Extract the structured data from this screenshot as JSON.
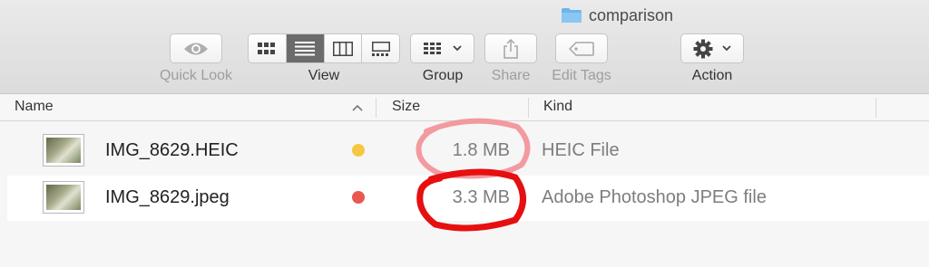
{
  "window": {
    "title": "comparison"
  },
  "toolbar": {
    "quick_look": "Quick Look",
    "view": "View",
    "group": "Group",
    "share": "Share",
    "edit_tags": "Edit Tags",
    "action": "Action"
  },
  "columns": {
    "name": "Name",
    "size": "Size",
    "kind": "Kind"
  },
  "files": [
    {
      "name": "IMG_8629.HEIC",
      "size": "1.8 MB",
      "kind": "HEIC File",
      "tag_color": "#f5c742"
    },
    {
      "name": "IMG_8629.jpeg",
      "size": "3.3 MB",
      "kind": "Adobe Photoshop JPEG file",
      "tag_color": "#e8584f"
    }
  ],
  "annotation_colors": {
    "first": "#f29aa0",
    "second": "#e61010"
  }
}
